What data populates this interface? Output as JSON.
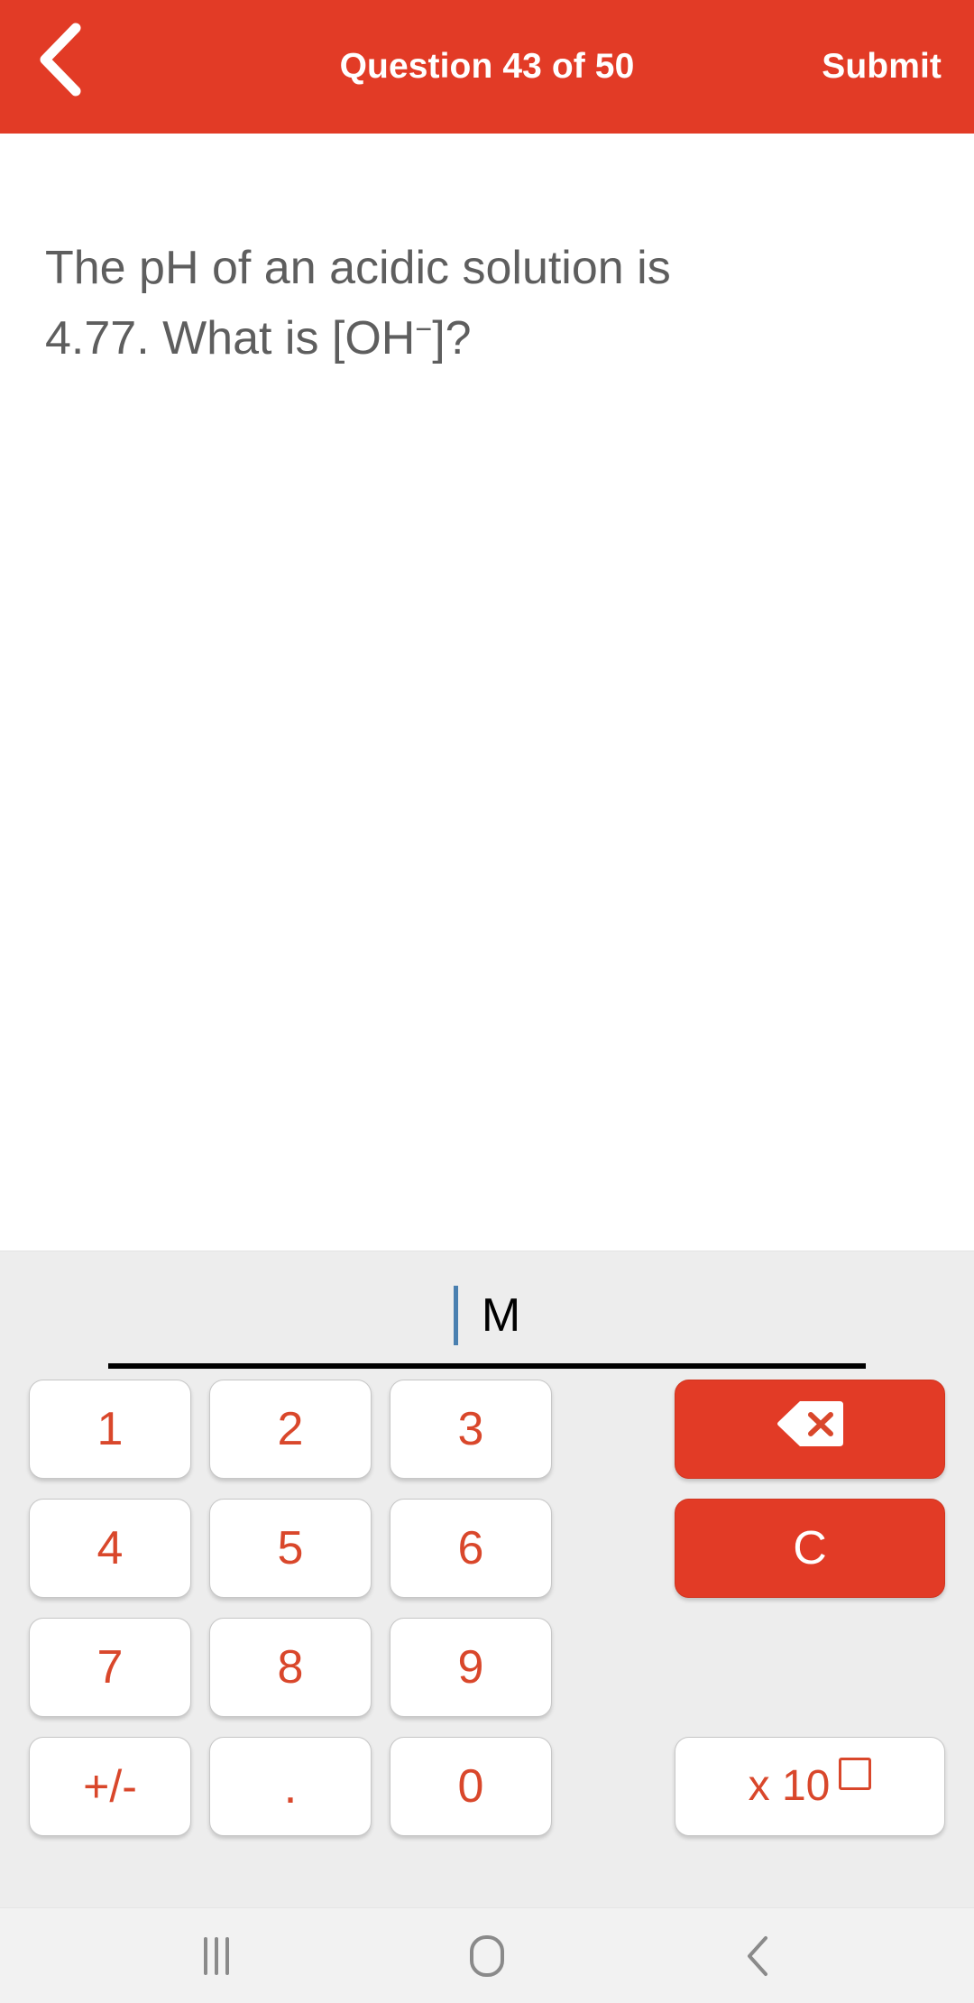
{
  "header": {
    "back_icon": "chevron-left-icon",
    "title": "Question 43 of 50",
    "submit_label": "Submit",
    "background_color": "#E23B26",
    "text_color": "#FFFFFF"
  },
  "question": {
    "line1": "The pH of an acidic solution is",
    "line2_prefix": "4.77. What is [OH",
    "line2_sup": "−",
    "line2_suffix": "]?",
    "text_color": "#5E5E5E"
  },
  "answer_field": {
    "value": "",
    "caret_visible": true,
    "caret_color": "#4A80B0",
    "unit": "M",
    "underline_color": "#000000"
  },
  "keypad": {
    "background_color": "#EDEDED",
    "number_key_color": "#D9472B",
    "action_key_background": "#E23B26",
    "keys": [
      {
        "name": "key-1",
        "label": "1"
      },
      {
        "name": "key-2",
        "label": "2"
      },
      {
        "name": "key-3",
        "label": "3"
      },
      {
        "name": "key-4",
        "label": "4"
      },
      {
        "name": "key-5",
        "label": "5"
      },
      {
        "name": "key-6",
        "label": "6"
      },
      {
        "name": "key-7",
        "label": "7"
      },
      {
        "name": "key-8",
        "label": "8"
      },
      {
        "name": "key-9",
        "label": "9"
      },
      {
        "name": "key-plus-minus",
        "label": "+/-"
      },
      {
        "name": "key-decimal",
        "label": "."
      },
      {
        "name": "key-0",
        "label": "0"
      }
    ],
    "backspace": {
      "icon": "backspace-icon",
      "label": ""
    },
    "clear": {
      "label": "C"
    },
    "exponent": {
      "label": "x 10",
      "placeholder_box": true
    }
  },
  "navbar": {
    "recents_icon": "recent-apps-icon",
    "home_icon": "home-icon",
    "back_icon": "back-chevron-icon",
    "icon_color": "#8A8A8A",
    "background_color": "#F2F2F2"
  }
}
